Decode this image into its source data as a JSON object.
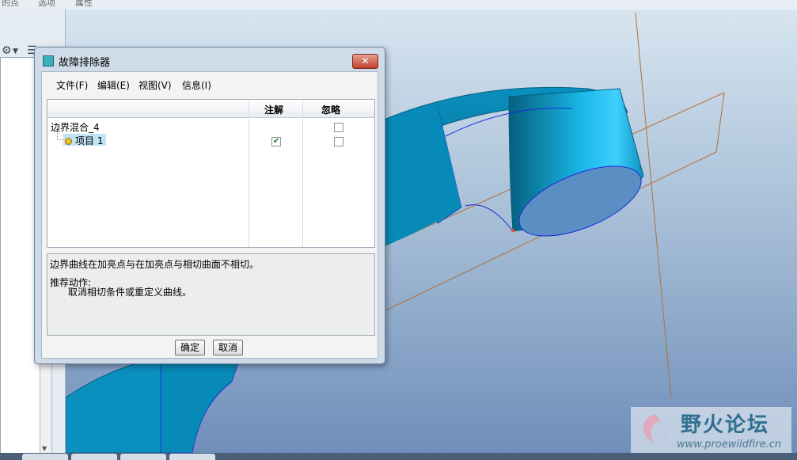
{
  "topstrip": {
    "items": [
      "的点",
      "选项",
      "属性"
    ]
  },
  "dialog": {
    "title": "故障排除器",
    "close_label": "✕",
    "menu": [
      "文件(F)",
      "编辑(E)",
      "视图(V)",
      "信息(I)"
    ],
    "columns": {
      "note": "注解",
      "ignore": "忽略"
    },
    "rows": [
      {
        "label": "边界混合_4",
        "note_checked": false,
        "ignore_checked": false
      },
      {
        "label": "项目 1",
        "note_checked": true,
        "ignore_checked": false
      }
    ],
    "message": {
      "line1": "边界曲线在加亮点与在加亮点与相切曲面不相切。",
      "line2": "推荐动作:",
      "line3": "取消相切条件或重定义曲线。"
    },
    "buttons": {
      "ok": "确定",
      "cancel": "取消"
    }
  },
  "watermark": {
    "cn": "野火论坛",
    "url": "www.proewildfire.cn"
  },
  "colors": {
    "part": "#0a8fbf",
    "part_dark": "#05607f",
    "datum": "#b07038",
    "curve": "#1a2ad8"
  }
}
